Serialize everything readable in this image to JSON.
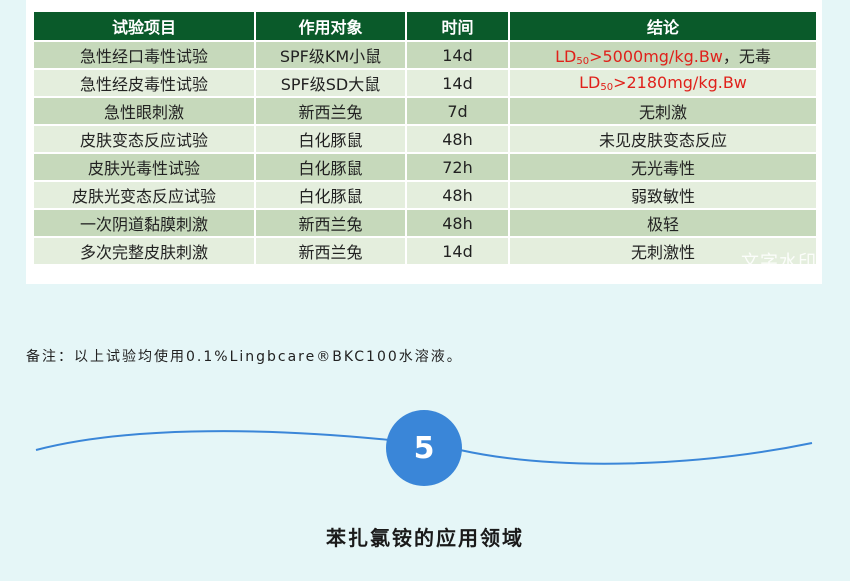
{
  "table": {
    "headers": [
      "试验项目",
      "作用对象",
      "时间",
      "结论"
    ],
    "rows": [
      {
        "item": "急性经口毒性试验",
        "subject": "SPF级KM小鼠",
        "time": "14d",
        "conclusion": {
          "ld": "LD",
          "sub": "50",
          "rest": ">5000mg/kg.Bw",
          "suffix": "，无毒"
        }
      },
      {
        "item": "急性经皮毒性试验",
        "subject": "SPF级SD大鼠",
        "time": "14d",
        "conclusion": {
          "ld": "LD",
          "sub": "50",
          "rest": ">2180mg/kg.Bw",
          "suffix": ""
        }
      },
      {
        "item": "急性眼刺激",
        "subject": "新西兰兔",
        "time": "7d",
        "conclusion": "无刺激"
      },
      {
        "item": "皮肤变态反应试验",
        "subject": "白化豚鼠",
        "time": "48h",
        "conclusion": "未见皮肤变态反应"
      },
      {
        "item": "皮肤光毒性试验",
        "subject": "白化豚鼠",
        "time": "72h",
        "conclusion": "无光毒性"
      },
      {
        "item": "皮肤光变态反应试验",
        "subject": "白化豚鼠",
        "time": "48h",
        "conclusion": "弱致敏性"
      },
      {
        "item": "一次阴道黏膜刺激",
        "subject": "新西兰兔",
        "time": "48h",
        "conclusion": "极轻"
      },
      {
        "item": "多次完整皮肤刺激",
        "subject": "新西兰兔",
        "time": "14d",
        "conclusion": "无刺激性"
      }
    ]
  },
  "watermark": "文字水印",
  "note": "备注：以上试验均使用0.1%Lingbcare®BKC100水溶液。",
  "section": {
    "number": "5",
    "title": "苯扎氯铵的应用领域"
  },
  "colors": {
    "header_bg": "#0a5a2a",
    "row_dark": "#c6d9bb",
    "row_light": "#e4eedd",
    "accent_red": "#e0211b",
    "circle": "#3a86d8"
  }
}
